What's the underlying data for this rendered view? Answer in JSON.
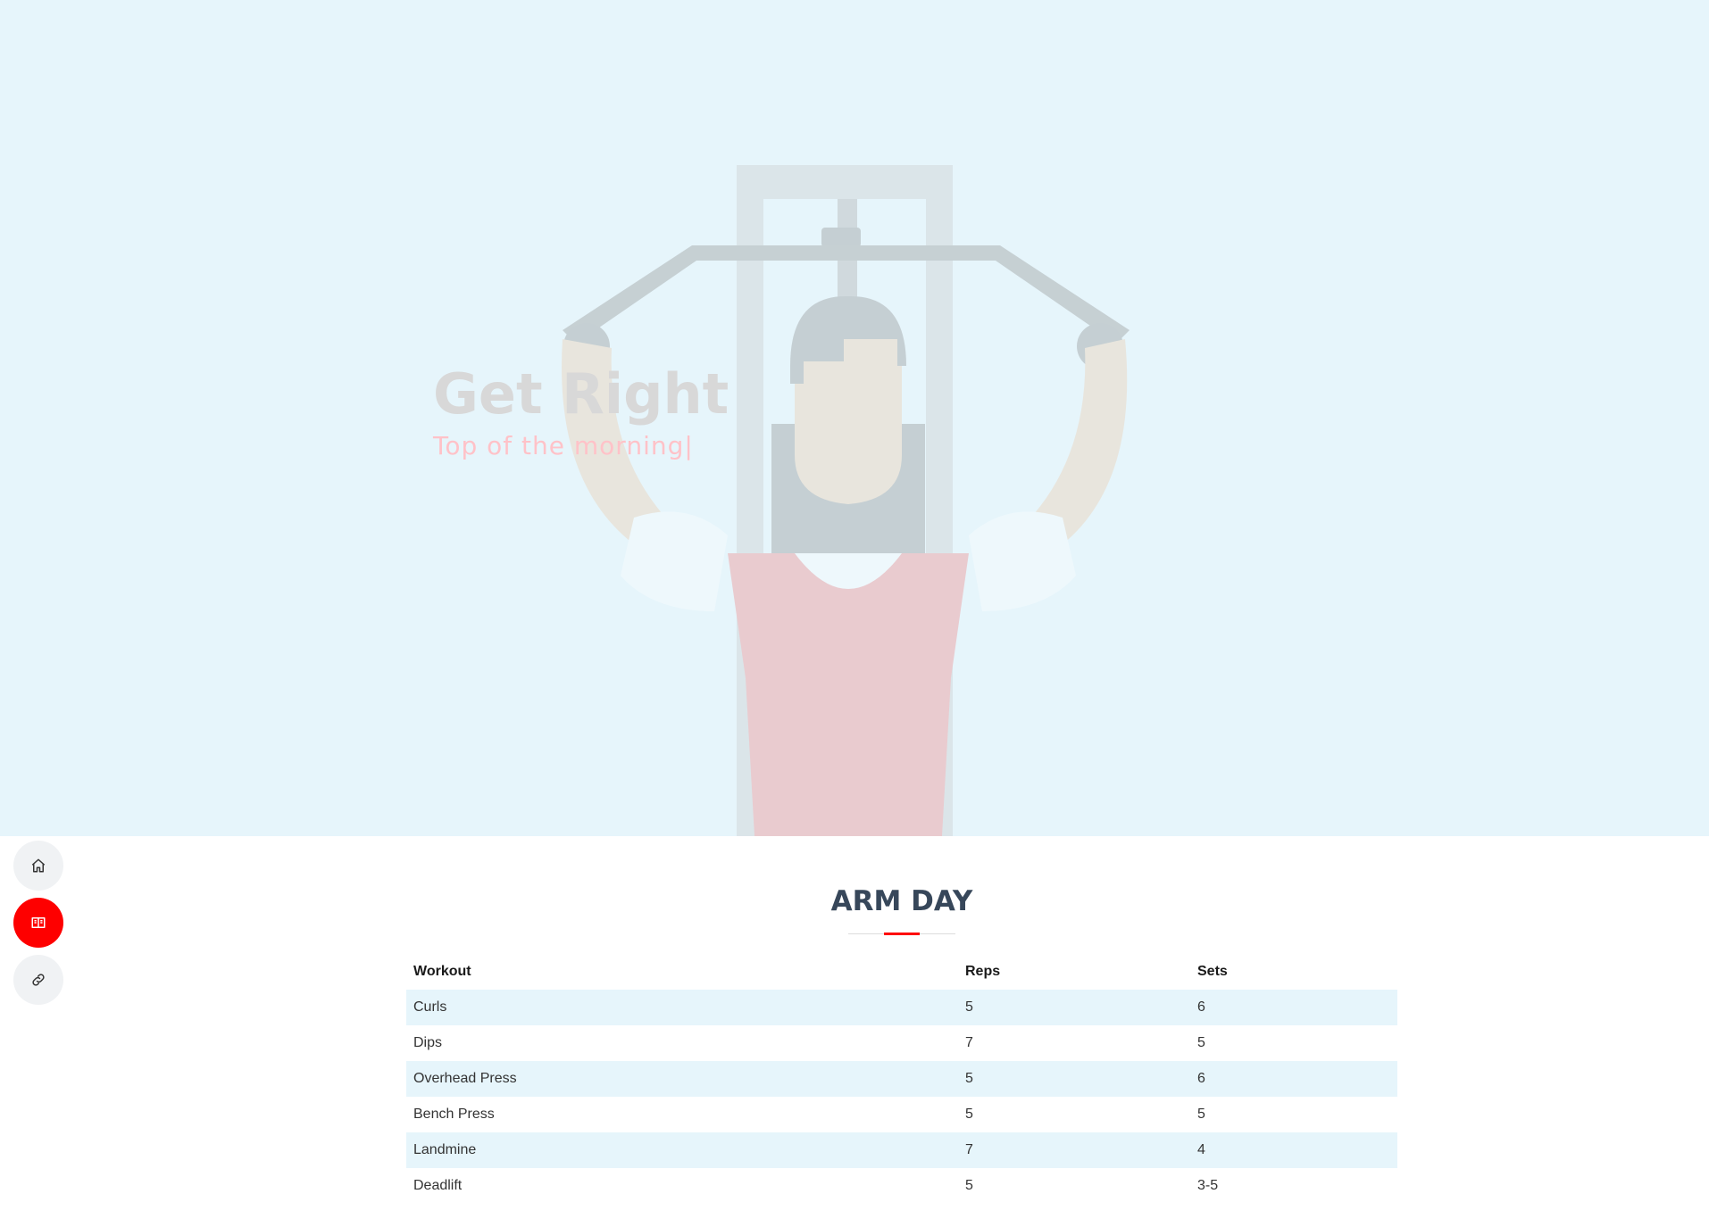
{
  "hero": {
    "title": "Get Right",
    "subtitle": "Top of the morning|"
  },
  "nav": {
    "items": [
      {
        "icon": "home-icon",
        "active": false
      },
      {
        "icon": "book-icon",
        "active": true
      },
      {
        "icon": "link-icon",
        "active": false
      }
    ]
  },
  "section": {
    "title": "ARM DAY",
    "accent_color": "#fe0000"
  },
  "table": {
    "headers": [
      "Workout",
      "Reps",
      "Sets"
    ],
    "rows": [
      [
        "Curls",
        "5",
        "6"
      ],
      [
        "Dips",
        "7",
        "5"
      ],
      [
        "Overhead Press",
        "5",
        "6"
      ],
      [
        "Bench Press",
        "5",
        "5"
      ],
      [
        "Landmine",
        "7",
        "4"
      ],
      [
        "Deadlift",
        "5",
        "3-5"
      ]
    ]
  },
  "colors": {
    "hero_bg": "#e6f5fb",
    "stripe_bg": "#e6f5fb",
    "title_text": "#37475a",
    "accent": "#fe0000"
  }
}
